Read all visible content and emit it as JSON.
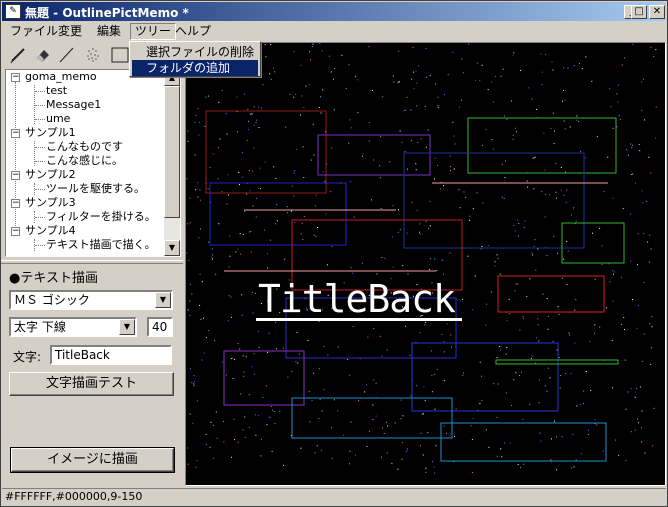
{
  "window": {
    "title": "無題 - OutlinePictMemo *",
    "icon": "app-icon",
    "controls": [
      "minimize-icon",
      "maximize-icon",
      "close-icon"
    ]
  },
  "menubar": {
    "items": [
      "ファイル",
      "変更",
      "編集",
      "ツリー",
      "ヘルプ"
    ],
    "open_index": 3
  },
  "toolbar": {
    "tools": [
      "pencil-icon",
      "eraser-icon",
      "line-icon",
      "spray-icon",
      "rectangle-icon"
    ],
    "colors": [
      "#3a6fb0",
      "#9a9a9a",
      "#d05a1e",
      "#4aa838"
    ]
  },
  "tree_menu": {
    "items": [
      "選択ファイルの削除",
      "フォルダの追加"
    ],
    "highlighted_index": 1
  },
  "tree": {
    "nodes": [
      {
        "label": "goma_memo",
        "level": 0
      },
      {
        "label": "test",
        "level": 1
      },
      {
        "label": "Message1",
        "level": 1
      },
      {
        "label": "ume",
        "level": 1
      },
      {
        "label": "サンプル1",
        "level": 0
      },
      {
        "label": "こんなものです",
        "level": 1
      },
      {
        "label": "こんな感じに。",
        "level": 1
      },
      {
        "label": "サンプル2",
        "level": 0
      },
      {
        "label": "ツールを駆使する。",
        "level": 1
      },
      {
        "label": "サンプル3",
        "level": 0
      },
      {
        "label": "フィルターを掛ける。",
        "level": 1
      },
      {
        "label": "サンプル4",
        "level": 0
      },
      {
        "label": "テキスト描画で描く。",
        "level": 1
      }
    ]
  },
  "text_panel": {
    "title": "●テキスト描画",
    "font": "ＭＳ ゴシック",
    "style": "太字 下線",
    "size": "40",
    "text_label": "文字:",
    "text_value": "TitleBack",
    "test_button": "文字描画テスト",
    "apply_button": "イメージに描画"
  },
  "canvas": {
    "text": "TitleBack",
    "background": "#000000"
  },
  "status": {
    "text": "#FFFFFF,#000000,9-150"
  }
}
